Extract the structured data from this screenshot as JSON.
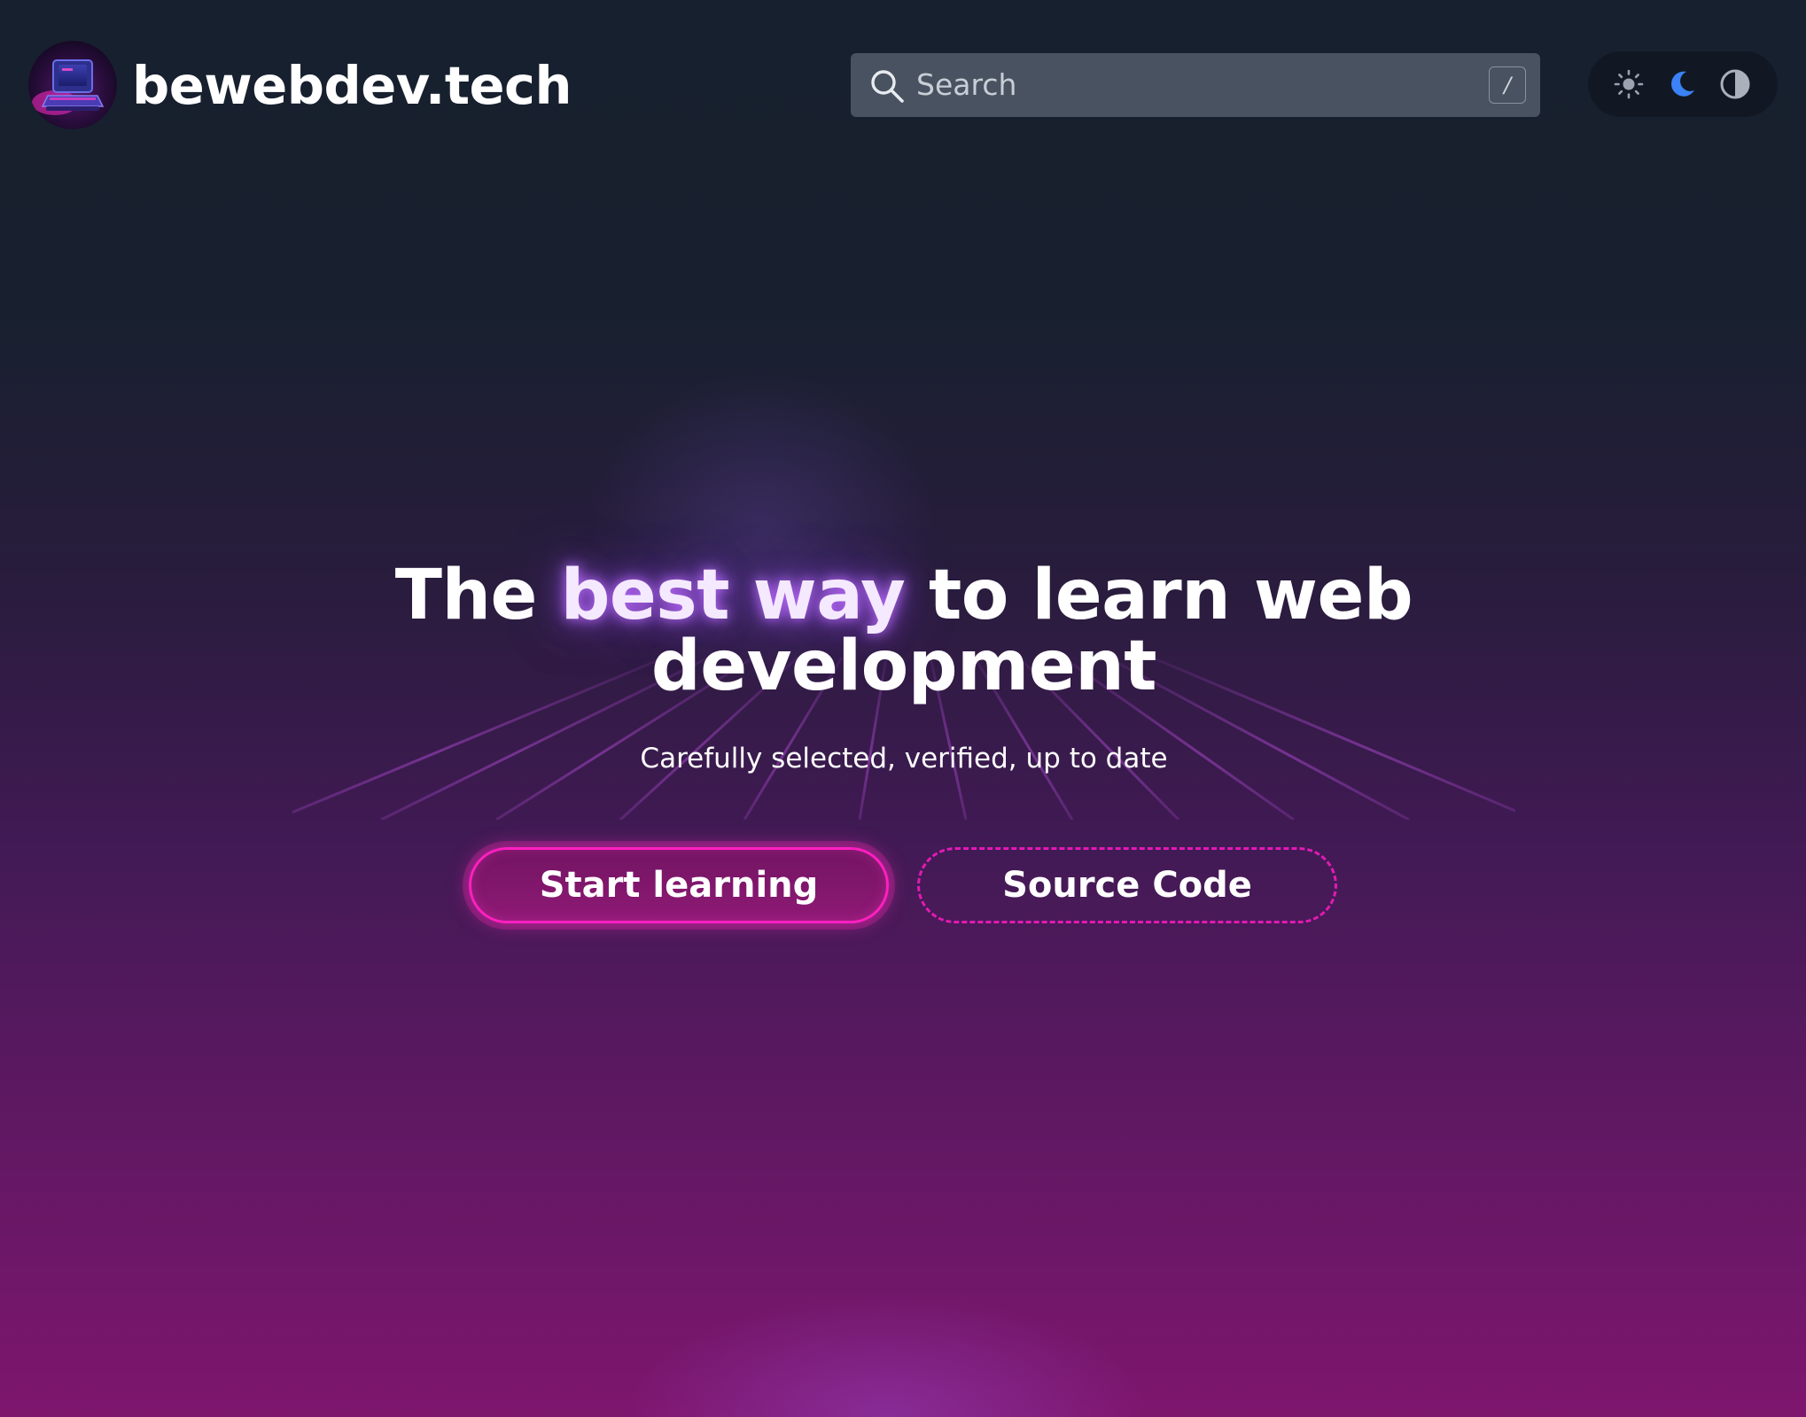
{
  "header": {
    "site_name": "bewebdev.tech",
    "logo_icon": "retro-computer-logo",
    "search": {
      "placeholder": "Search",
      "shortcut": "/",
      "icon": "search-icon"
    },
    "theme_switch": {
      "options": [
        {
          "name": "light",
          "icon": "sun-icon"
        },
        {
          "name": "dark",
          "icon": "moon-icon",
          "active": true
        },
        {
          "name": "system",
          "icon": "contrast-icon"
        }
      ]
    }
  },
  "hero": {
    "title_part1": "The ",
    "title_accent": "best way",
    "title_part2": " to learn web development",
    "subtitle": "Carefully selected, verified, up to date",
    "primary_button": "Start learning",
    "secondary_button": "Source Code"
  },
  "colors": {
    "background_top": "#17202e",
    "background_bottom": "#7e166e",
    "accent_pink": "#ff1fc0",
    "active_theme_blue": "#3b82f6",
    "search_bg": "#485260"
  }
}
